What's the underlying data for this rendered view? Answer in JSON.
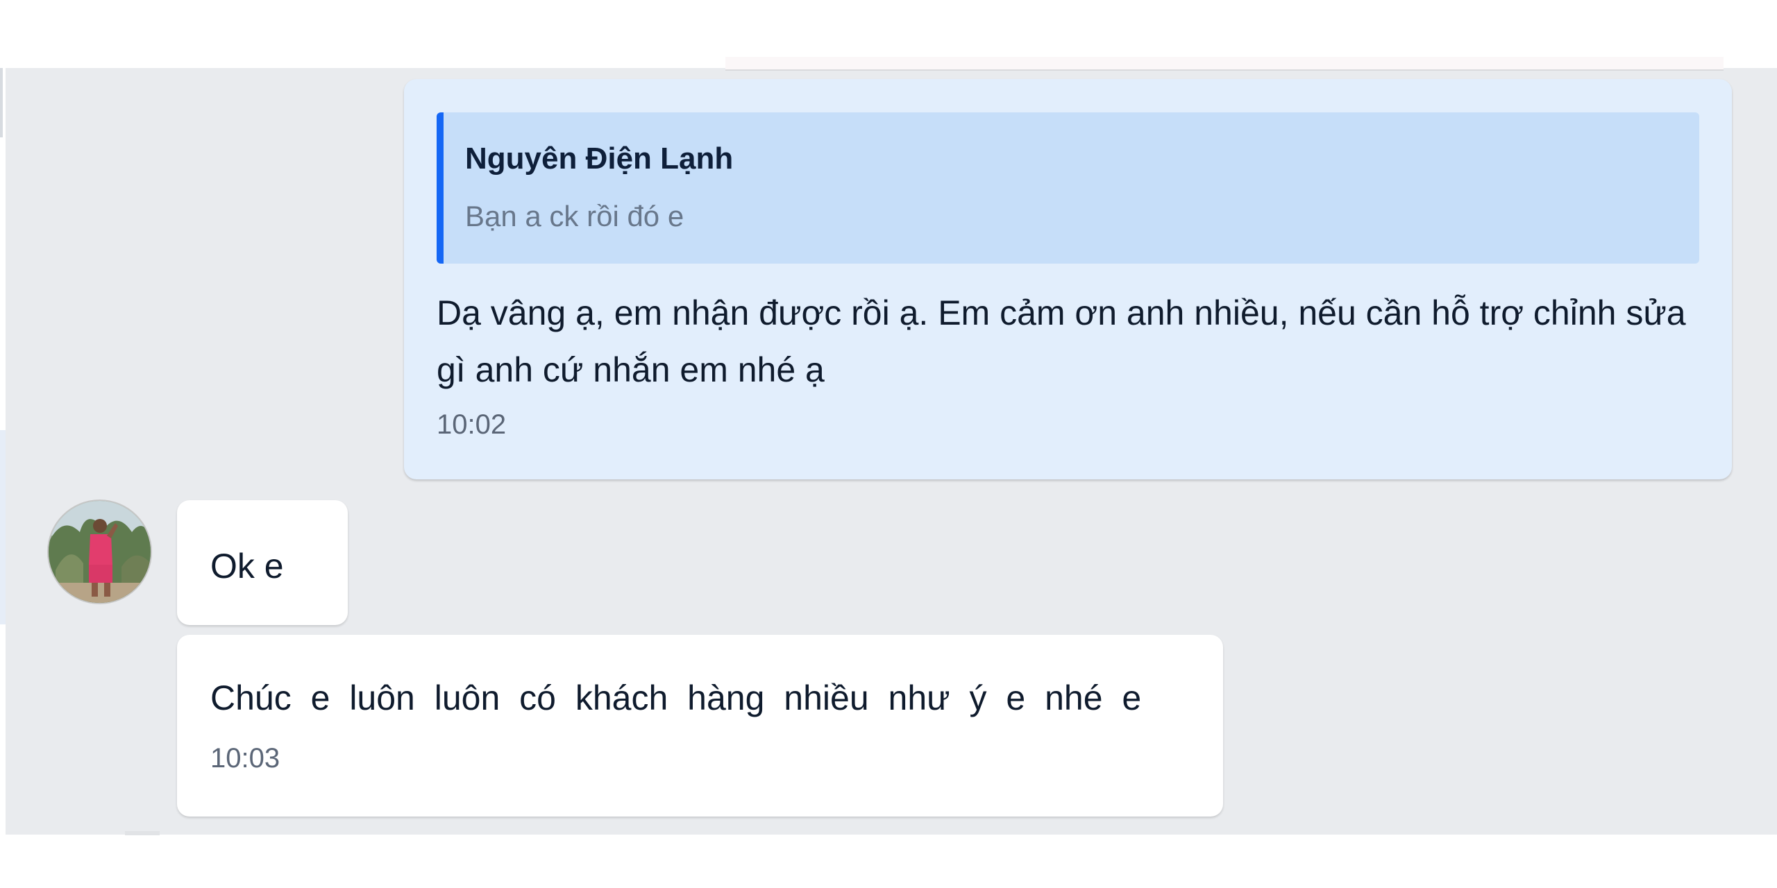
{
  "conversation": {
    "outgoing": {
      "reply_quote": {
        "sender": "Nguyên Điện Lạnh",
        "text": "Bạn a ck rồi đó e"
      },
      "text": "Dạ vâng ạ, em nhận được rồi ạ. Em cảm ơn anh nhiều, nếu cần hỗ trợ chỉnh sửa gì anh cứ nhắn em nhé ạ",
      "time": "10:02"
    },
    "incoming": [
      {
        "text": "Ok e"
      },
      {
        "text": "Chúc e luôn luôn có khách hàng nhiều như ý e nhé e",
        "time": "10:03"
      }
    ]
  },
  "colors": {
    "panel_bg": "#e9ebee",
    "outgoing_bubble": "#e2eefc",
    "quote_bg": "#c6def9",
    "quote_accent": "#1567f5",
    "incoming_bubble": "#ffffff"
  },
  "icons": {
    "avatar": "contact-avatar-photo"
  }
}
